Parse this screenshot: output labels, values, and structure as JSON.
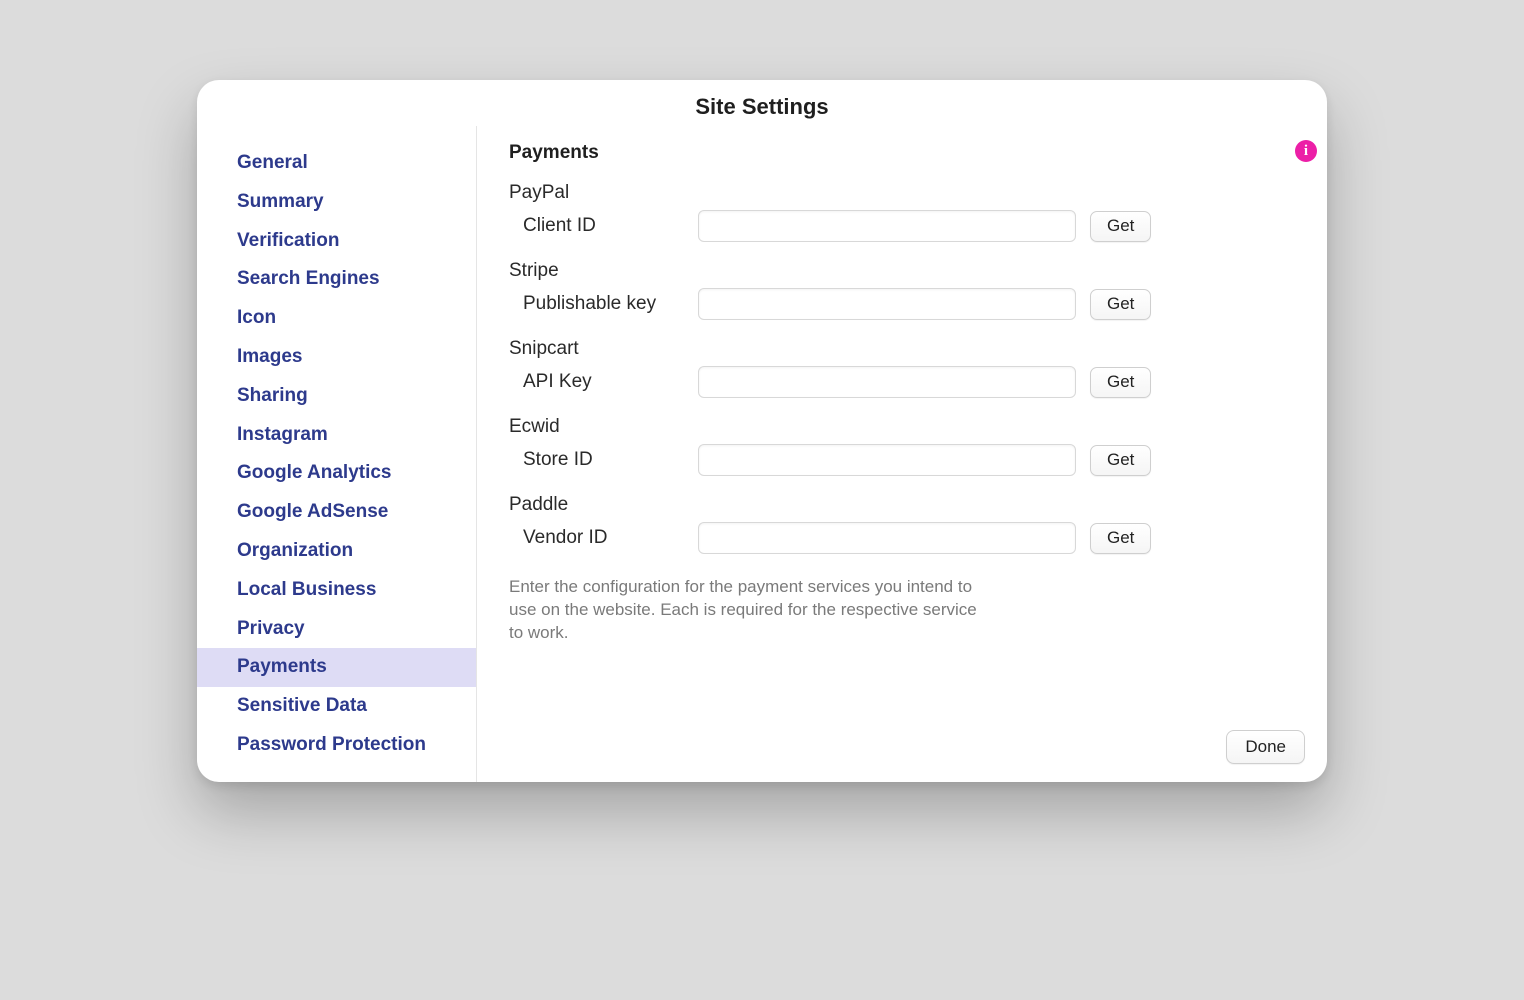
{
  "title": "Site Settings",
  "info_icon_label": "i",
  "sidebar": {
    "items": [
      {
        "label": "General",
        "selected": false
      },
      {
        "label": "Summary",
        "selected": false
      },
      {
        "label": "Verification",
        "selected": false
      },
      {
        "label": "Search Engines",
        "selected": false
      },
      {
        "label": "Icon",
        "selected": false
      },
      {
        "label": "Images",
        "selected": false
      },
      {
        "label": "Sharing",
        "selected": false
      },
      {
        "label": "Instagram",
        "selected": false
      },
      {
        "label": "Google Analytics",
        "selected": false
      },
      {
        "label": "Google AdSense",
        "selected": false
      },
      {
        "label": "Organization",
        "selected": false
      },
      {
        "label": "Local Business",
        "selected": false
      },
      {
        "label": "Privacy",
        "selected": false
      },
      {
        "label": "Payments",
        "selected": true
      },
      {
        "label": "Sensitive Data",
        "selected": false
      },
      {
        "label": "Password Protection",
        "selected": false
      }
    ]
  },
  "content": {
    "section_title": "Payments",
    "providers": [
      {
        "name": "PayPal",
        "field_label": "Client ID",
        "value": "",
        "get_label": "Get"
      },
      {
        "name": "Stripe",
        "field_label": "Publishable key",
        "value": "",
        "get_label": "Get"
      },
      {
        "name": "Snipcart",
        "field_label": "API Key",
        "value": "",
        "get_label": "Get"
      },
      {
        "name": "Ecwid",
        "field_label": "Store ID",
        "value": "",
        "get_label": "Get"
      },
      {
        "name": "Paddle",
        "field_label": "Vendor ID",
        "value": "",
        "get_label": "Get"
      }
    ],
    "help_text": "Enter the configuration for the payment services you intend to use on the website. Each is required for the respective service to work."
  },
  "footer": {
    "done_label": "Done"
  }
}
